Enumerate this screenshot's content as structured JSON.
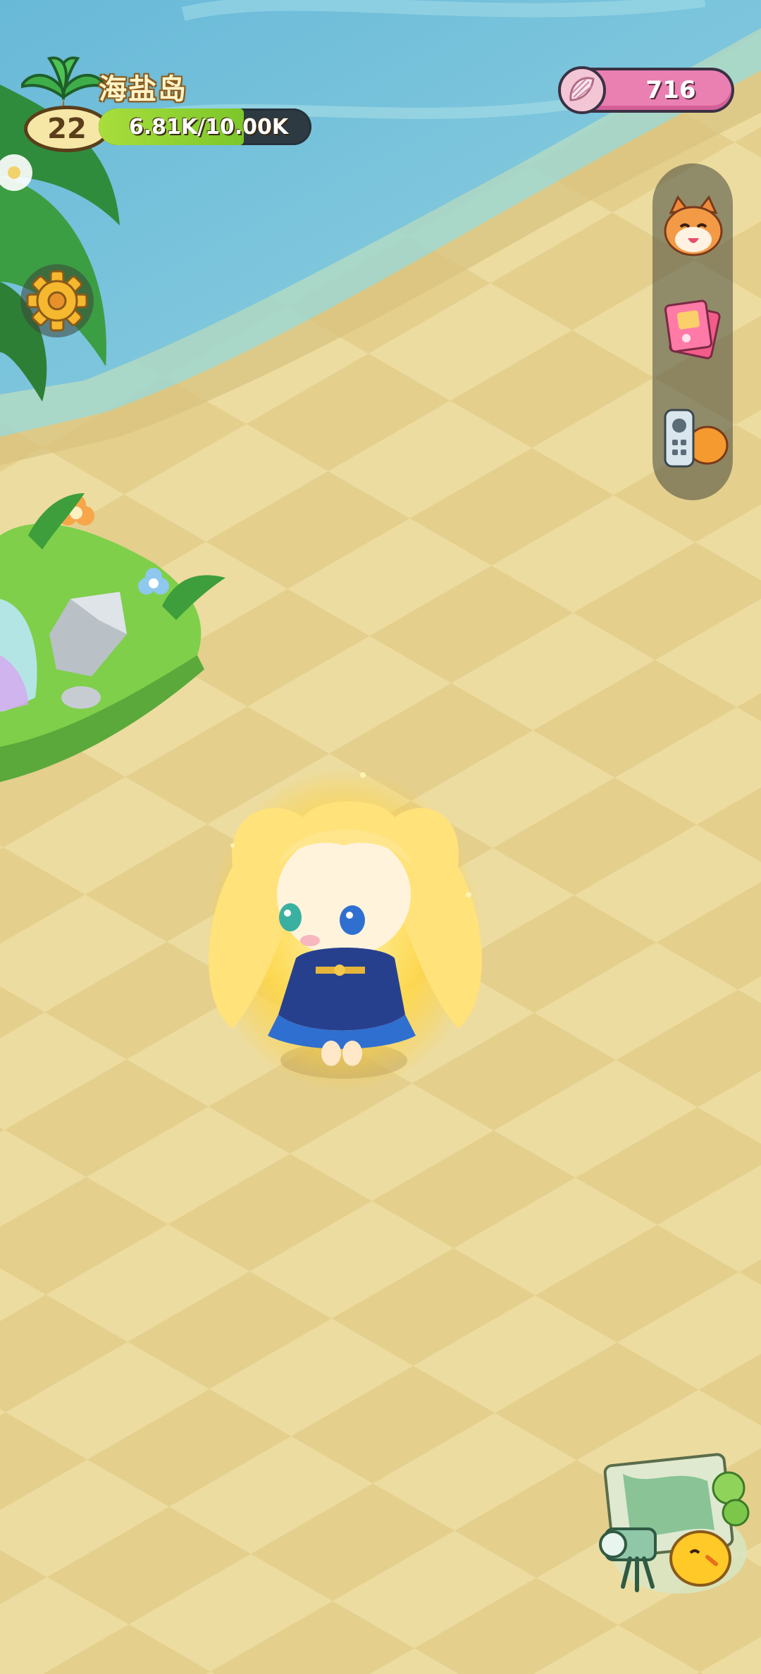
{
  "island": {
    "name": "海盐岛",
    "level": "22",
    "xp_text": "6.81K/10.00K",
    "xp_fraction": 0.681
  },
  "currency": {
    "icon": "shell-icon",
    "value": "716"
  },
  "side_menu": [
    {
      "name": "cat-friends-icon"
    },
    {
      "name": "album-book-icon"
    },
    {
      "name": "remote-control-icon"
    }
  ],
  "colors": {
    "sand_light": "#efe0a6",
    "sand_dark": "#e3cd8a",
    "sea": "#7cc6dc",
    "xp_fill": "#8fd12e",
    "currency_pink": "#ea7fb1"
  }
}
